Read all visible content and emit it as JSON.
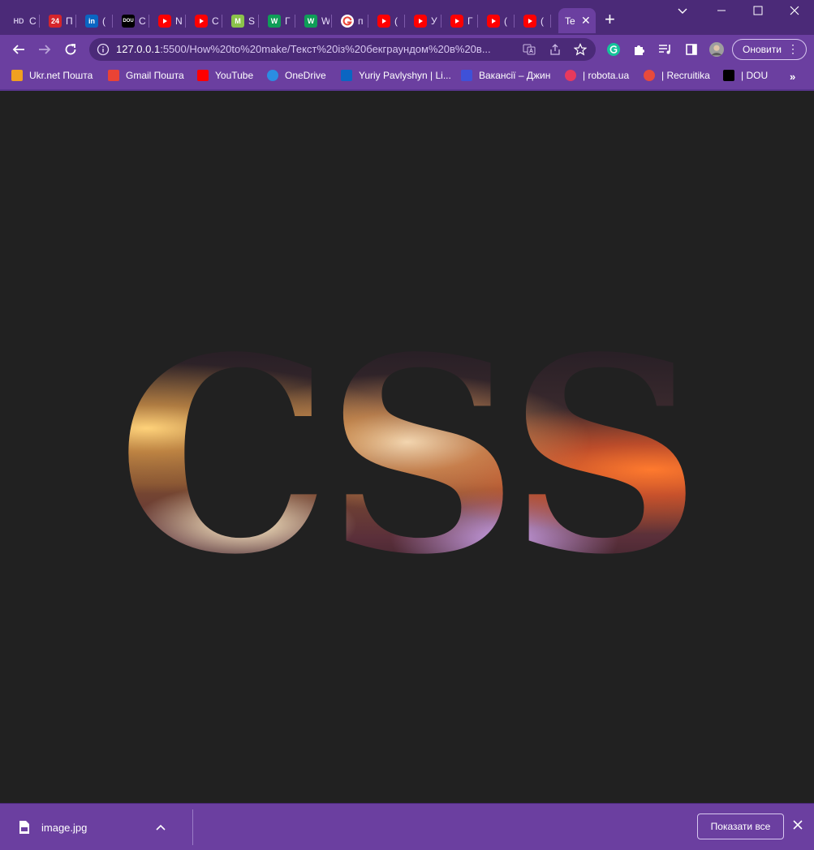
{
  "tabs": [
    {
      "favicon": "HD",
      "title": "C",
      "favicon_color": "#4b2a78",
      "favicon_text_color": "#cfc2e6"
    },
    {
      "favicon": "24",
      "title": "П",
      "favicon_color": "#d6252b"
    },
    {
      "favicon": "in",
      "title": "(",
      "favicon_color": "#0a66c2"
    },
    {
      "favicon": "DOU",
      "title": "C",
      "favicon_color": "#000000"
    },
    {
      "favicon": "youtube-icon",
      "title": "N",
      "favicon_color": "#ff0000"
    },
    {
      "favicon": "youtube-icon",
      "title": "C",
      "favicon_color": "#ff0000"
    },
    {
      "favicon": "M",
      "title": "S",
      "favicon_color": "#8bc34a"
    },
    {
      "favicon": "W",
      "title": "Г",
      "favicon_color": "#0f9d58"
    },
    {
      "favicon": "W",
      "title": "W",
      "favicon_color": "#0f9d58"
    },
    {
      "favicon": "google-icon",
      "title": "п",
      "favicon_color": "#ffffff"
    },
    {
      "favicon": "youtube-icon",
      "title": "(",
      "favicon_color": "#ff0000"
    },
    {
      "favicon": "youtube-icon",
      "title": "У",
      "favicon_color": "#ff0000"
    },
    {
      "favicon": "youtube-icon",
      "title": "Г",
      "favicon_color": "#ff0000"
    },
    {
      "favicon": "youtube-icon",
      "title": "(",
      "favicon_color": "#ff0000"
    },
    {
      "favicon": "youtube-icon",
      "title": "(",
      "favicon_color": "#ff0000"
    }
  ],
  "active_tab": {
    "title": "Te"
  },
  "address_bar": {
    "host": "127.0.0.1",
    "path": ":5500/How%20to%20make/Текст%20із%20бекграундом%20в%20в..."
  },
  "toolbar": {
    "update_label": "Оновити"
  },
  "bookmarks": [
    {
      "label": "Ukr.net Пошта",
      "icon": "ukrnet-icon",
      "color": "#f0a020"
    },
    {
      "label": "Gmail Пошта",
      "icon": "gmail-icon",
      "color": "#ea4335"
    },
    {
      "label": "YouTube",
      "icon": "youtube-icon",
      "color": "#ff0000"
    },
    {
      "label": "OneDrive",
      "icon": "onedrive-icon",
      "color": "#2b8de2"
    },
    {
      "label": "Yuriy Pavlyshyn | Li...",
      "icon": "linkedin-icon",
      "color": "#0a66c2"
    },
    {
      "label": "Вакансії – Джин",
      "icon": "djinni-icon",
      "color": "#3f51d8"
    },
    {
      "label": "| robota.ua",
      "icon": "robota-icon",
      "color": "#e8395d"
    },
    {
      "label": "| Recruitika",
      "icon": "recruitika-icon",
      "color": "#e84a3c"
    },
    {
      "label": "| DOU",
      "icon": "dou-icon",
      "color": "#000000"
    }
  ],
  "page": {
    "headline": "CSS"
  },
  "download_shelf": {
    "file_name": "image.jpg",
    "show_all_label": "Показати все"
  },
  "colors": {
    "frame": "#4b2a78",
    "toolbar": "#6b3fa0",
    "page_background": "#212121"
  }
}
